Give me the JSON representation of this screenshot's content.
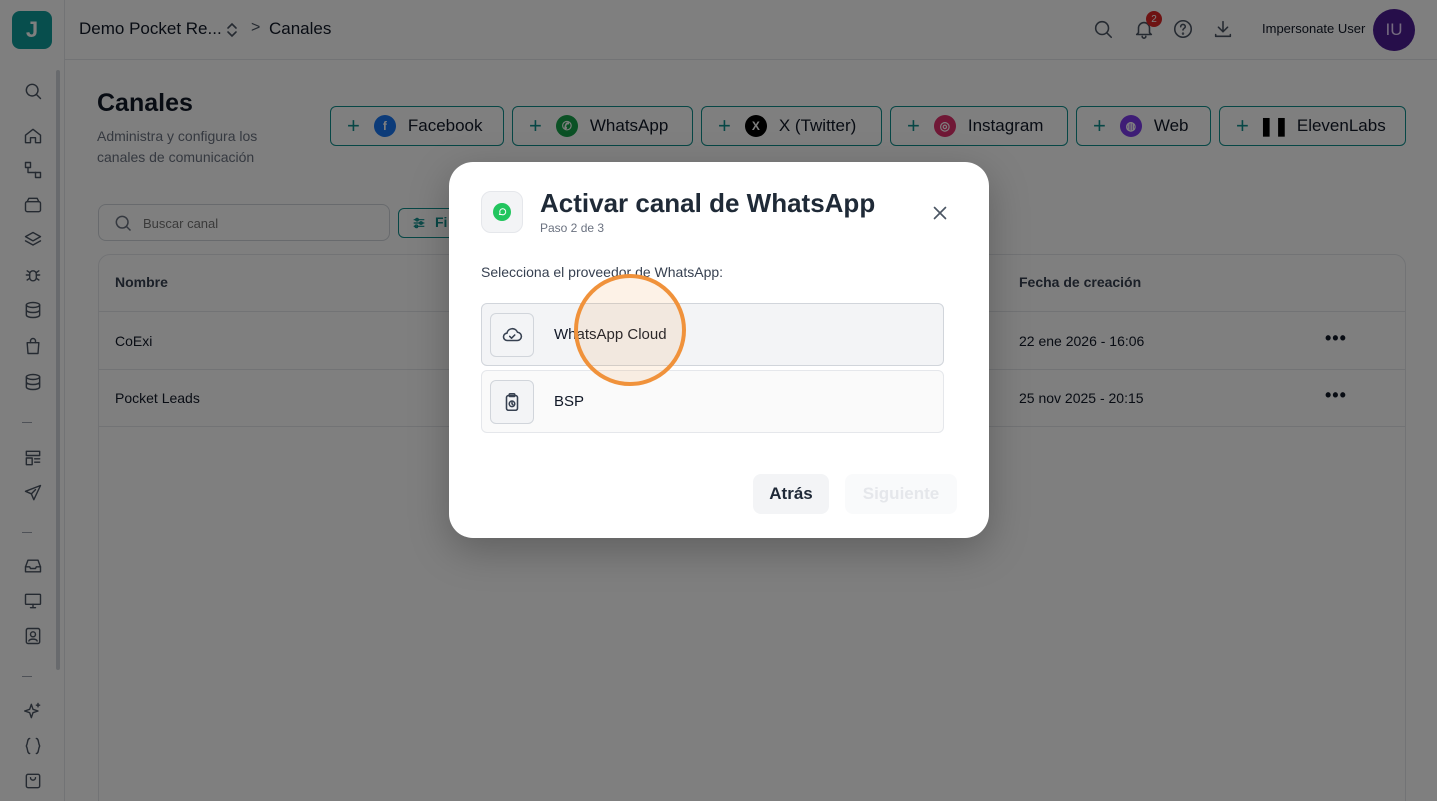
{
  "topbar": {
    "project_name": "Demo Pocket Re...",
    "breadcrumb_sep": ">",
    "breadcrumb_current": "Canales",
    "notification_count": "2",
    "user_name": "Impersonate User",
    "avatar_initials": "IU"
  },
  "sidebar": {
    "logo_letter": "J"
  },
  "page": {
    "title": "Canales",
    "subtitle": "Administra y configura los canales de comunicación",
    "channel_buttons": [
      {
        "label": "Facebook",
        "icon": "facebook-icon",
        "color": "#1877f2"
      },
      {
        "label": "WhatsApp",
        "icon": "whatsapp-icon",
        "color": "#16a34a"
      },
      {
        "label": "X (Twitter)",
        "icon": "x-icon",
        "color": "#000000"
      },
      {
        "label": "Instagram",
        "icon": "instagram-icon",
        "color": "#e1306c"
      },
      {
        "label": "Web",
        "icon": "globe-icon",
        "color": "#7c3aed"
      },
      {
        "label": "ElevenLabs",
        "icon": "elevenlabs-icon",
        "color": "#000000"
      }
    ],
    "search_placeholder": "Buscar canal",
    "filter_label": "Fi"
  },
  "table": {
    "headers": {
      "name": "Nombre",
      "created": "Fecha de creación"
    },
    "rows": [
      {
        "name": "CoExi",
        "created": "22 ene 2026 - 16:06",
        "menu": "•••"
      },
      {
        "name": "Pocket Leads",
        "created": "25 nov 2025 - 20:15",
        "menu": "•••"
      }
    ]
  },
  "modal": {
    "title": "Activar canal de WhatsApp",
    "step": "Paso 2 de 3",
    "prompt": "Selecciona el proveedor de WhatsApp:",
    "options": [
      {
        "label": "WhatsApp Cloud",
        "icon": "cloud-check-icon"
      },
      {
        "label": "BSP",
        "icon": "clipboard-clock-icon"
      }
    ],
    "back_label": "Atrás",
    "next_label": "Siguiente"
  },
  "colors": {
    "accent": "#0f8f8c",
    "click_highlight": "#f0923b"
  }
}
